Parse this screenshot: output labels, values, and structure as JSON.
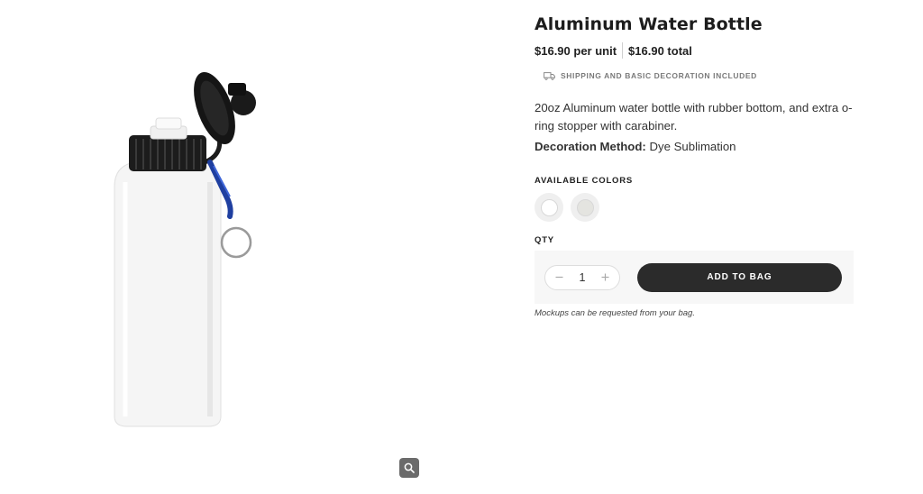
{
  "product": {
    "title": "Aluminum Water Bottle",
    "price_unit": "$16.90 per unit",
    "price_total": "$16.90 total",
    "shipping_note": "SHIPPING AND BASIC DECORATION INCLUDED",
    "shipping_icon": "truck-icon",
    "description": "20oz Aluminum water bottle with rubber bottom, and extra o-ring stopper with carabiner.",
    "decoration_label": "Decoration Method:",
    "decoration_value": "Dye Sublimation"
  },
  "colors": {
    "label": "AVAILABLE COLORS",
    "swatches": [
      {
        "color": "#ffffff"
      },
      {
        "color": "#e4e4e0"
      }
    ]
  },
  "purchase": {
    "qty_label": "QTY",
    "quantity": "1",
    "minus_icon": "minus-icon",
    "plus_icon": "plus-icon",
    "add_button_label": "ADD TO BAG",
    "mockup_note": "Mockups can be requested from your bag."
  },
  "gallery": {
    "zoom_icon": "magnifier-icon"
  },
  "theme": {
    "button_color": "#2b2b2b",
    "zoom_button_color": "#6b6b6b"
  }
}
